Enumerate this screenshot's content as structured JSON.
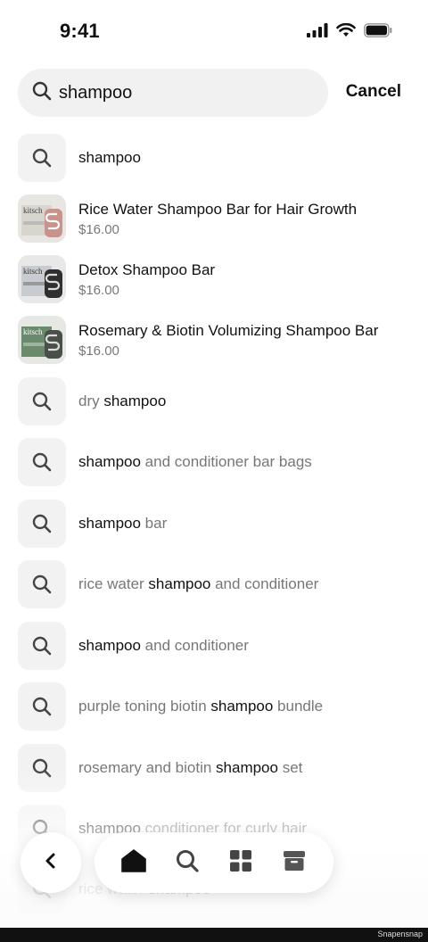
{
  "status_bar": {
    "time": "9:41"
  },
  "search": {
    "query": "shampoo",
    "cancel_label": "Cancel"
  },
  "suggestions_top": {
    "label": "shampoo"
  },
  "products": [
    {
      "title": "Rice Water Shampoo Bar for Hair Growth",
      "price": "$16.00",
      "color": "#d9a59a"
    },
    {
      "title": "Detox Shampoo Bar",
      "price": "$16.00",
      "color": "#3a3a3a"
    },
    {
      "title": "Rosemary & Biotin Volumizing Shampoo Bar",
      "price": "$16.00",
      "color": "#5b7a5d"
    }
  ],
  "suggestions": [
    {
      "pre": "dry ",
      "bold": "shampoo",
      "post": ""
    },
    {
      "pre": "",
      "bold": "shampoo",
      "post": " and conditioner bar bags"
    },
    {
      "pre": "",
      "bold": "shampoo",
      "post": " bar"
    },
    {
      "pre": "rice water ",
      "bold": "shampoo",
      "post": " and conditioner"
    },
    {
      "pre": "",
      "bold": "shampoo",
      "post": " and conditioner"
    },
    {
      "pre": "purple toning biotin ",
      "bold": "shampoo",
      "post": " bundle"
    },
    {
      "pre": "rosemary and biotin ",
      "bold": "shampoo",
      "post": " set"
    },
    {
      "pre": "",
      "bold": "shampoo",
      "post": " conditioner for curly hair"
    },
    {
      "pre": "rice water ",
      "bold": "shampoo",
      "post": ""
    }
  ],
  "product_brand": "kitsch",
  "footer": {
    "watermark": "Snapensnap"
  },
  "colors": {
    "accent": "#111111",
    "muted": "#777777",
    "tile_bg": "#f2f2f3"
  },
  "icons": {
    "status": [
      "signal-icon",
      "wifi-icon",
      "battery-icon"
    ],
    "tabs": [
      "home-icon",
      "search-icon",
      "grid-icon",
      "box-icon"
    ],
    "back": "chevron-left-icon"
  }
}
